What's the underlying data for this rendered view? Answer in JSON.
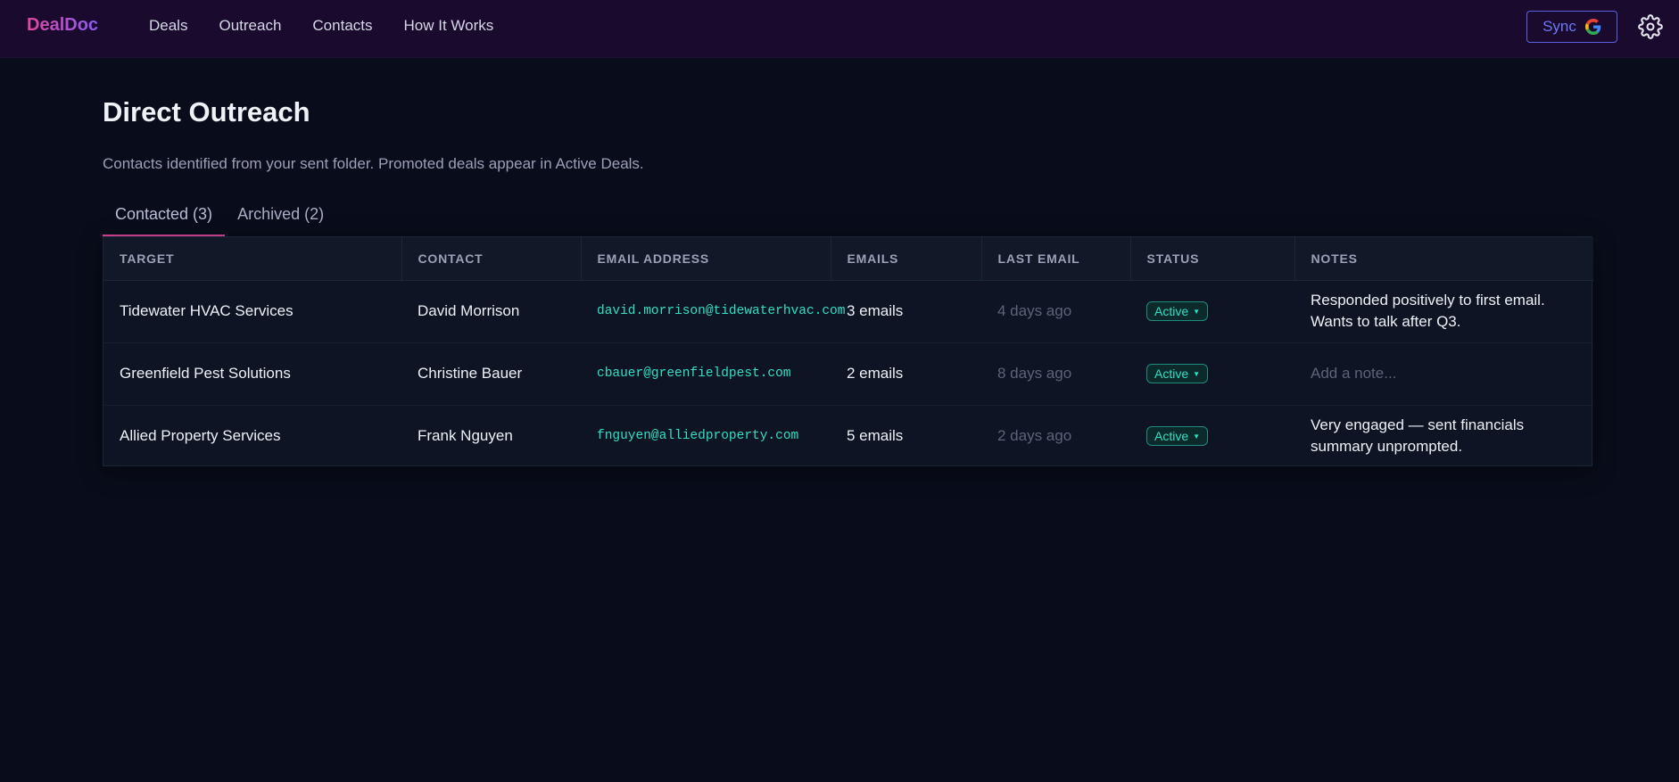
{
  "app": {
    "logo": "DealDoc"
  },
  "nav": {
    "deals": "Deals",
    "outreach": "Outreach",
    "contacts": "Contacts",
    "how": "How It Works"
  },
  "sync": {
    "label": "Sync"
  },
  "page": {
    "title": "Direct Outreach",
    "subtitle": "Contacts identified from your sent folder. Promoted deals appear in Active Deals."
  },
  "tabs": [
    {
      "label": "Contacted (3)"
    },
    {
      "label": "Archived (2)"
    }
  ],
  "table": {
    "headers": [
      "TARGET",
      "CONTACT",
      "EMAIL ADDRESS",
      "EMAILS",
      "LAST EMAIL",
      "STATUS",
      "NOTES"
    ],
    "rows": [
      {
        "target": "Tidewater HVAC Services",
        "contact": "David Morrison",
        "email": "david.morrison@tidewaterhvac.com",
        "emails": "3 emails",
        "last": "4 days ago",
        "status": "Active",
        "notes": [
          "Responded positively to first email.",
          "Wants to talk after Q3."
        ],
        "note_placeholder": ""
      },
      {
        "target": "Greenfield Pest Solutions",
        "contact": "Christine Bauer",
        "email": "cbauer@greenfieldpest.com",
        "emails": "2 emails",
        "last": "8 days ago",
        "status": "Active",
        "notes": [
          "",
          ""
        ],
        "note_placeholder": "Add a note..."
      },
      {
        "target": "Allied Property Services",
        "contact": "Frank Nguyen",
        "email": "fnguyen@alliedproperty.com",
        "emails": "5 emails",
        "last": "2 days ago",
        "status": "Active",
        "notes": [
          "Very engaged — sent financials",
          "summary unprompted."
        ],
        "note_placeholder": ""
      }
    ]
  },
  "colors": {
    "accent": "#d9469c",
    "teal": "#2fe0c4",
    "sync": "#6c78f5",
    "background": "#090c1a",
    "topbar": "#1a0b2e"
  }
}
